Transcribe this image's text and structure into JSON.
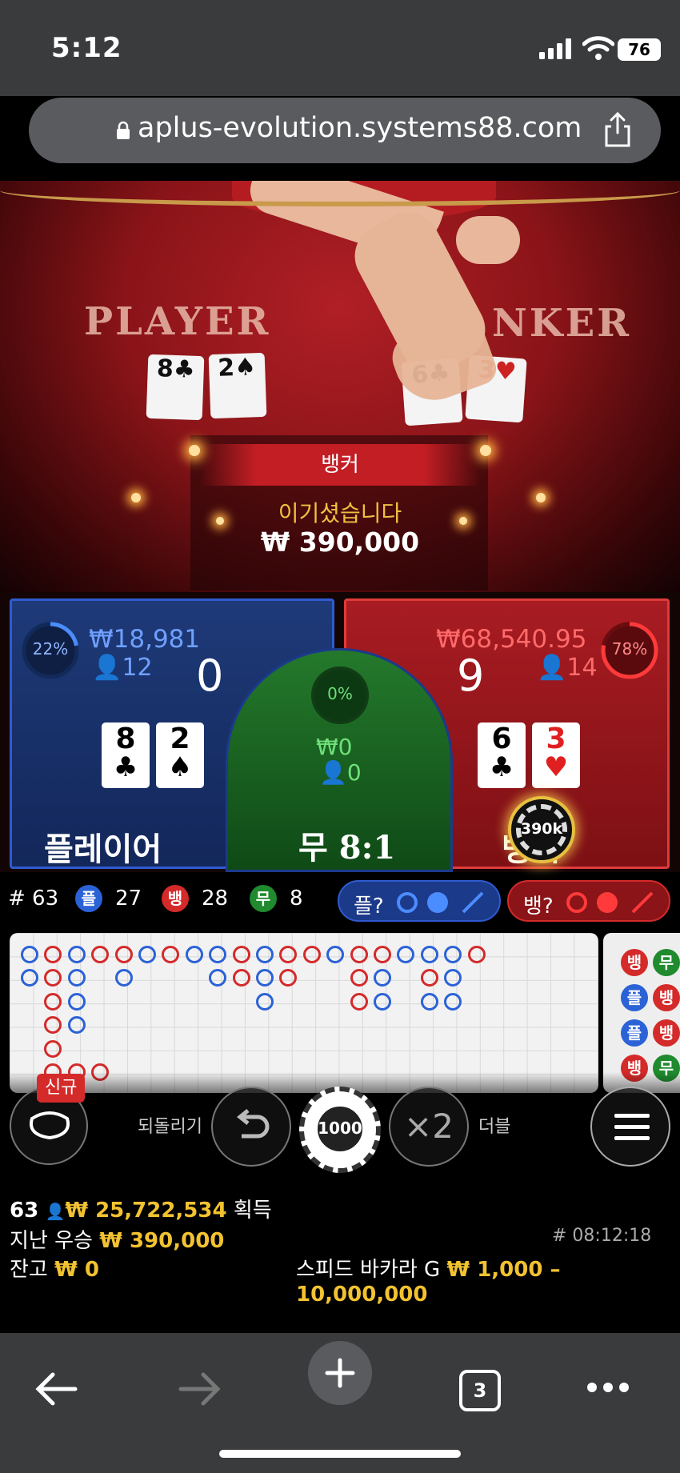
{
  "status_bar": {
    "time": "5:12",
    "battery": "76"
  },
  "browser": {
    "url": "aplus-evolution.systems88.com",
    "tabs_count": "3"
  },
  "table": {
    "player_text": "PLAYER",
    "banker_text": "NKER",
    "player_cards": [
      {
        "rank": "8",
        "suit": "♣"
      },
      {
        "rank": "2",
        "suit": "♠"
      }
    ],
    "banker_cards": [
      {
        "rank": "6",
        "suit": "♣"
      },
      {
        "rank": "3",
        "suit": "♥"
      }
    ]
  },
  "result": {
    "winner": "뱅커",
    "message": "이기셨습니다",
    "amount": "₩ 390,000"
  },
  "player": {
    "percent": "22%",
    "percent_value": 22,
    "amount": "₩18,981",
    "users": "12",
    "score": "0",
    "label": "플레이어",
    "cards": [
      {
        "rank": "8",
        "suit": "♣",
        "color": "#000"
      },
      {
        "rank": "2",
        "suit": "♠",
        "color": "#000"
      }
    ]
  },
  "tie": {
    "percent": "0%",
    "amount": "₩0",
    "users": "0",
    "label": "무",
    "payout": "8:1"
  },
  "banker": {
    "percent": "78%",
    "percent_value": 78,
    "amount": "₩68,540.95",
    "users": "14",
    "score": "9",
    "label": "뱅커",
    "chip": "390k",
    "cards": [
      {
        "rank": "6",
        "suit": "♣",
        "color": "#000"
      },
      {
        "rank": "3",
        "suit": "♥",
        "color": "#e02020"
      }
    ]
  },
  "stats": {
    "round": "# 63",
    "player_label": "플",
    "player_count": "27",
    "banker_label": "뱅",
    "banker_count": "28",
    "tie_label": "무",
    "tie_count": "8",
    "player_predict": "플?",
    "banker_predict": "뱅?"
  },
  "side_road": [
    "뱅",
    "무",
    "플",
    "뱅",
    "플",
    "뱅",
    "뱅",
    "무"
  ],
  "controls": {
    "new_badge": "신규",
    "undo_label": "되돌리기",
    "chip_value": "1000",
    "double_symbol": "×2",
    "double_label": "더블"
  },
  "info": {
    "players": "63",
    "total_won": "₩ 25,722,534",
    "won_label": "획득",
    "last_win_label": "지난 우승",
    "last_win": "₩ 390,000",
    "game_id": "# 08:12:18",
    "balance_label": "잔고",
    "balance": "₩ 0",
    "game_name": "스피드 바카라 G",
    "limits": "₩ 1,000 – 10,000,000"
  },
  "colors": {
    "player": "#2f5bd0",
    "banker": "#d42a2a",
    "tie": "#1f8a2e",
    "gold": "#f2c230"
  }
}
